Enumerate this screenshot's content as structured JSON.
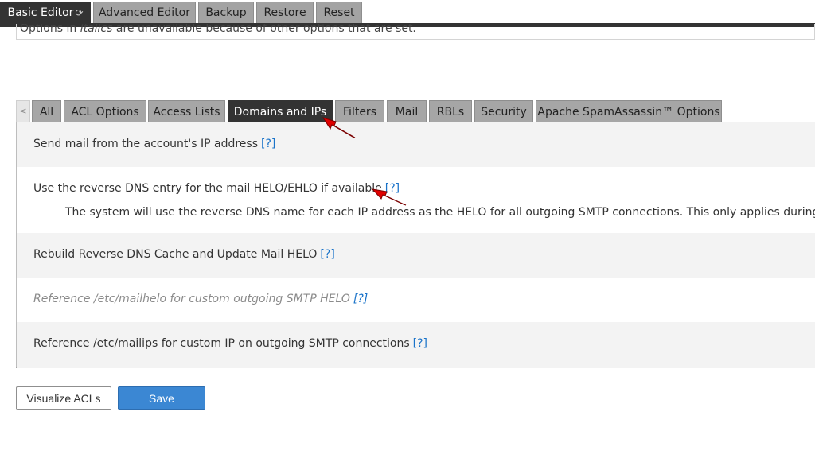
{
  "top_tabs": [
    {
      "label": "Basic Editor",
      "active": true,
      "icon": "refresh-icon"
    },
    {
      "label": "Advanced Editor",
      "active": false
    },
    {
      "label": "Backup",
      "active": false
    },
    {
      "label": "Restore",
      "active": false
    },
    {
      "label": "Reset",
      "active": false
    }
  ],
  "notice": {
    "prefix": "Options in ",
    "emphasis": "italics",
    "suffix": " are unavailable because of other options that are set."
  },
  "category_tabs": {
    "scroll_left": "<",
    "items": [
      {
        "label": "All",
        "active": false
      },
      {
        "label": "ACL Options",
        "active": false
      },
      {
        "label": "Access Lists",
        "active": false
      },
      {
        "label": "Domains and IPs",
        "active": true
      },
      {
        "label": "Filters",
        "active": false
      },
      {
        "label": "Mail",
        "active": false
      },
      {
        "label": "RBLs",
        "active": false
      },
      {
        "label": "Security",
        "active": false
      },
      {
        "label": "Apache SpamAssassin™ Options",
        "active": false
      }
    ]
  },
  "options": [
    {
      "label": "Send mail from the account's IP address",
      "help": "[?]",
      "disabled": false
    },
    {
      "label": "Use the reverse DNS entry for the mail HELO/EHLO if available",
      "help": "[?]",
      "disabled": false,
      "description": "The system will use the reverse DNS name for each IP address as the HELO for all outgoing SMTP connections. This only applies during the HELO/"
    },
    {
      "label": "Rebuild Reverse DNS Cache and Update Mail HELO",
      "help": "[?]",
      "disabled": false
    },
    {
      "label": "Reference /etc/mailhelo for custom outgoing SMTP HELO",
      "help": "[?]",
      "disabled": true
    },
    {
      "label": "Reference /etc/mailips for custom IP on outgoing SMTP connections",
      "help": "[?]",
      "disabled": false
    }
  ],
  "buttons": {
    "visualize_label": "Visualize ACLs",
    "save_label": "Save"
  },
  "colors": {
    "active_tab": "#333333",
    "inactive_tab": "#a6a6a6",
    "link": "#1a73c9",
    "primary_button": "#3b87d3",
    "annotation_arrow": "#e00000"
  }
}
